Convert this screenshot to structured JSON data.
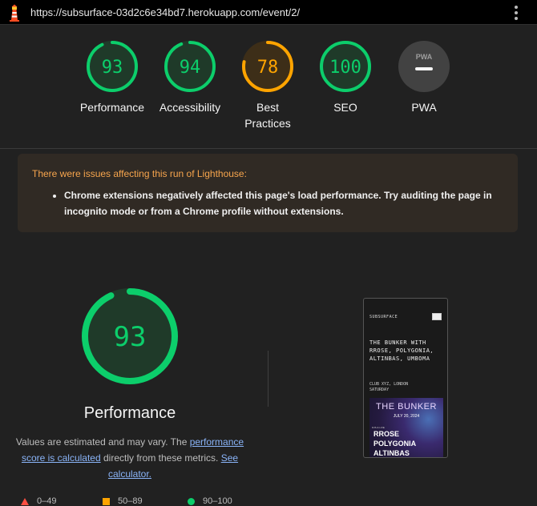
{
  "browser": {
    "url": "https://subsurface-03d2c6e34bd7.herokuapp.com/event/2/"
  },
  "colors": {
    "pass": "#0cce6b",
    "average": "#ffa400",
    "fail": "#ff4e42",
    "neutral": "#9e9e9e"
  },
  "scores": [
    {
      "label": "Performance",
      "score": "93",
      "value": 93,
      "status": "pass"
    },
    {
      "label": "Accessibility",
      "score": "94",
      "value": 94,
      "status": "pass"
    },
    {
      "label": "Best Practices",
      "score": "78",
      "value": 78,
      "status": "average"
    },
    {
      "label": "SEO",
      "score": "100",
      "value": 100,
      "status": "pass"
    },
    {
      "label": "PWA",
      "score": "PWA",
      "value": null,
      "status": "neutral"
    }
  ],
  "warning": {
    "title": "There were issues affecting this run of Lighthouse:",
    "items": [
      "Chrome extensions negatively affected this page's load performance. Try auditing the page in incognito mode or from a Chrome profile without extensions."
    ]
  },
  "performance": {
    "score": "93",
    "value": 93,
    "title": "Performance",
    "desc_prefix": "Values are estimated and may vary. The ",
    "desc_link1": "performance score is calculated",
    "desc_middle": " directly from these metrics. ",
    "desc_link2": "See calculator."
  },
  "legend": [
    {
      "range": "0–49",
      "shape": "triangle"
    },
    {
      "range": "50–89",
      "shape": "square"
    },
    {
      "range": "90–100",
      "shape": "circle"
    }
  ],
  "screenshot": {
    "brand": "SUBSURFACE",
    "heading": "THE BUNKER WITH RROSE, POLYGONIA, ALTINBAS, UMBOMA",
    "venue_line1": "CLUB XYZ, LONDON",
    "venue_line2": "SATURDAY",
    "poster_title": "THE BUNKER",
    "poster_date": "JULY 20, 2024",
    "poster_small": "DJS & LIVE",
    "poster_artists": [
      "RROSE",
      "POLYGONIA",
      "ALTINBAS"
    ]
  }
}
